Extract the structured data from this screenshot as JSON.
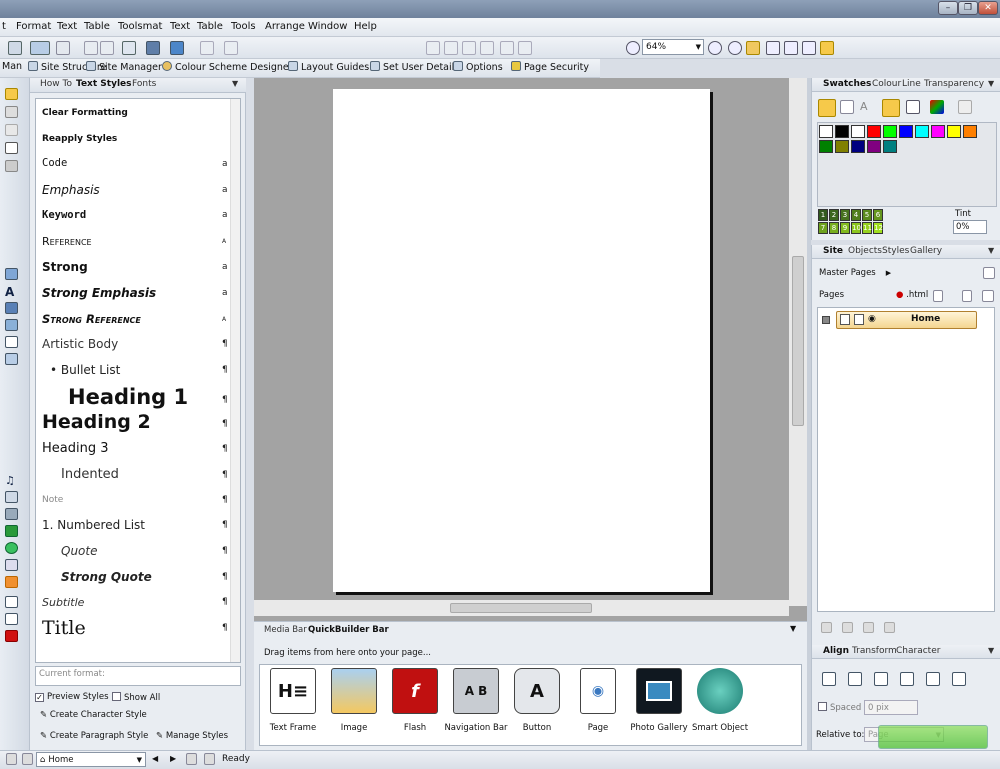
{
  "menu": [
    "t",
    "Format",
    "Text",
    "Table",
    "Toolsmat",
    "Text",
    "Table",
    "Tools",
    "Arrange",
    "Window",
    "Help"
  ],
  "toolbar": {
    "zoom": "64%"
  },
  "toolbar2": {
    "left_stub": "Man",
    "items": [
      "Site Structure",
      "Site Manager",
      "Colour Scheme Designer",
      "Layout Guides",
      "Set User Details",
      "Options",
      "Page Security"
    ]
  },
  "textstyles": {
    "tabs": [
      "How To",
      "Text Styles",
      "Fonts"
    ],
    "styles": [
      {
        "label": "Clear Formatting",
        "mark": ""
      },
      {
        "label": "Reapply Styles",
        "mark": ""
      },
      {
        "label": "Code",
        "mark": "a"
      },
      {
        "label": "Emphasis",
        "mark": "a"
      },
      {
        "label": "Keyword",
        "mark": "a"
      },
      {
        "label": "Reference",
        "mark": "a"
      },
      {
        "label": "Strong",
        "mark": "a"
      },
      {
        "label": "Strong Emphasis",
        "mark": "a"
      },
      {
        "label": "Strong Reference",
        "mark": "a"
      },
      {
        "label": "Artistic Body",
        "mark": "¶"
      },
      {
        "label": "• Bullet List",
        "mark": "¶"
      },
      {
        "label": "Heading 1",
        "mark": "¶"
      },
      {
        "label": "Heading 2",
        "mark": "¶"
      },
      {
        "label": "Heading 3",
        "mark": "¶"
      },
      {
        "label": "Indented",
        "mark": "¶"
      },
      {
        "label": "Note",
        "mark": "¶"
      },
      {
        "label": "1.  Numbered List",
        "mark": "¶"
      },
      {
        "label": "Quote",
        "mark": "¶"
      },
      {
        "label": "Strong Quote",
        "mark": "¶"
      },
      {
        "label": "Subtitle",
        "mark": "¶"
      },
      {
        "label": "Title",
        "mark": "¶"
      }
    ],
    "current_format_placeholder": "Current format:",
    "preview_styles": "Preview Styles",
    "show_all": "Show All",
    "create_character_style": "Create Character Style",
    "create_paragraph_style": "Create Paragraph Style",
    "manage_styles": "Manage Styles"
  },
  "quickbuilder": {
    "tabs": [
      "Media Bar",
      "QuickBuilder Bar"
    ],
    "hint": "Drag items from here onto your page...",
    "items": [
      {
        "label": "Text Frame",
        "icon": "text-frame-icon"
      },
      {
        "label": "Image",
        "icon": "image-icon"
      },
      {
        "label": "Flash",
        "icon": "flash-icon"
      },
      {
        "label": "Navigation Bar",
        "icon": "navigation-bar-icon"
      },
      {
        "label": "Button",
        "icon": "button-icon"
      },
      {
        "label": "Page",
        "icon": "page-icon"
      },
      {
        "label": "Photo Gallery",
        "icon": "photo-gallery-icon"
      },
      {
        "label": "Smart Object",
        "icon": "smart-object-icon"
      }
    ]
  },
  "swatches": {
    "tabs": [
      "Swatches",
      "Colour",
      "Line",
      "Transparency"
    ],
    "colors": [
      "#ffffff",
      "#000000",
      "#ffffff",
      "#ff0000",
      "#00ff00",
      "#0000ff",
      "#00ffff",
      "#ff00ff",
      "#ffff00",
      "#ff8000",
      "#008000",
      "#808000",
      "#000080",
      "#800080",
      "#008080"
    ],
    "tints": [
      "1",
      "2",
      "3",
      "4",
      "5",
      "6",
      "7",
      "8",
      "9",
      "10",
      "11",
      "12"
    ],
    "tint_label": "Tint",
    "tint_value": "0%"
  },
  "site": {
    "tabs": [
      "Site",
      "Objects",
      "Styles",
      "Gallery"
    ],
    "master_pages": "Master Pages",
    "pages": "Pages",
    "ext": ".html",
    "page_name": "Home"
  },
  "align": {
    "tabs": [
      "Align",
      "Transform",
      "Character"
    ],
    "spaced": "Spaced",
    "spaced_value": "0 pix",
    "relative_to": "Relative to:",
    "relative_value": "Page"
  },
  "status": {
    "page_select": "Home",
    "ready": "Ready"
  }
}
